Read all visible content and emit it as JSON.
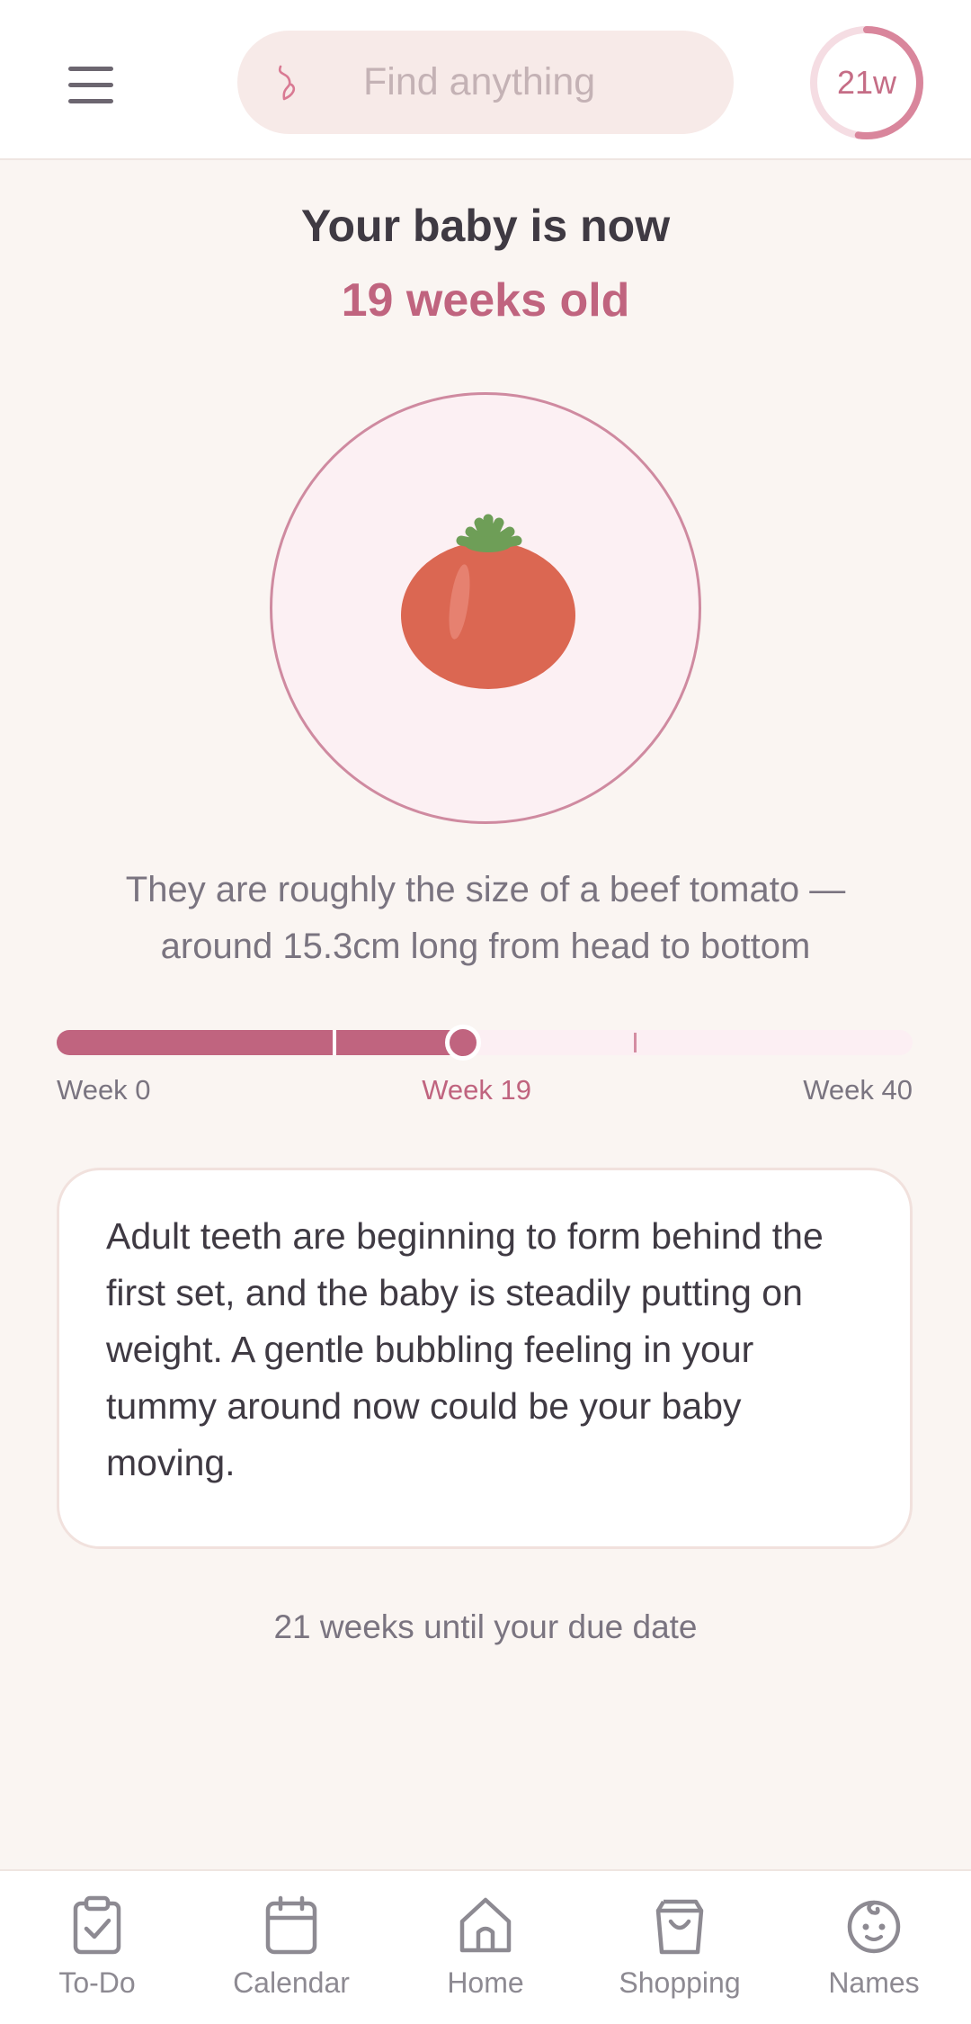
{
  "header": {
    "menu_icon": "hamburger-menu-icon",
    "search": {
      "icon": "pregnant-silhouette-icon",
      "placeholder": "Find anything"
    },
    "week_badge": {
      "label": "21w",
      "progress_fraction": 0.525,
      "accent": "#D9869C"
    }
  },
  "hero": {
    "title": "Your baby is now",
    "subtitle": "19 weeks old",
    "illustration": "beef-tomato-icon",
    "size_description": "They are roughly the size of a beef tomato — around 15.3cm long from head to bottom"
  },
  "progress": {
    "start_label": "Week 0",
    "current_label": "Week 19",
    "end_label": "Week 40",
    "current_week": 19,
    "total_weeks": 40,
    "trimester_marks": [
      13,
      27
    ]
  },
  "info_card": {
    "text": "Adult teeth are beginning to form behind the first set, and the baby is steadily putting on weight. A gentle bubbling feeling in your tummy around now could be your baby moving."
  },
  "due_date_text": "21 weeks until your due date",
  "bottom_nav": [
    {
      "label": "To-Do",
      "icon": "clipboard-check-icon"
    },
    {
      "label": "Calendar",
      "icon": "calendar-icon"
    },
    {
      "label": "Home",
      "icon": "home-icon"
    },
    {
      "label": "Shopping",
      "icon": "shopping-bag-icon"
    },
    {
      "label": "Names",
      "icon": "baby-face-icon"
    }
  ],
  "colors": {
    "accent": "#C0647F",
    "background": "#FAF5F2",
    "track": "#FCEFF3"
  }
}
